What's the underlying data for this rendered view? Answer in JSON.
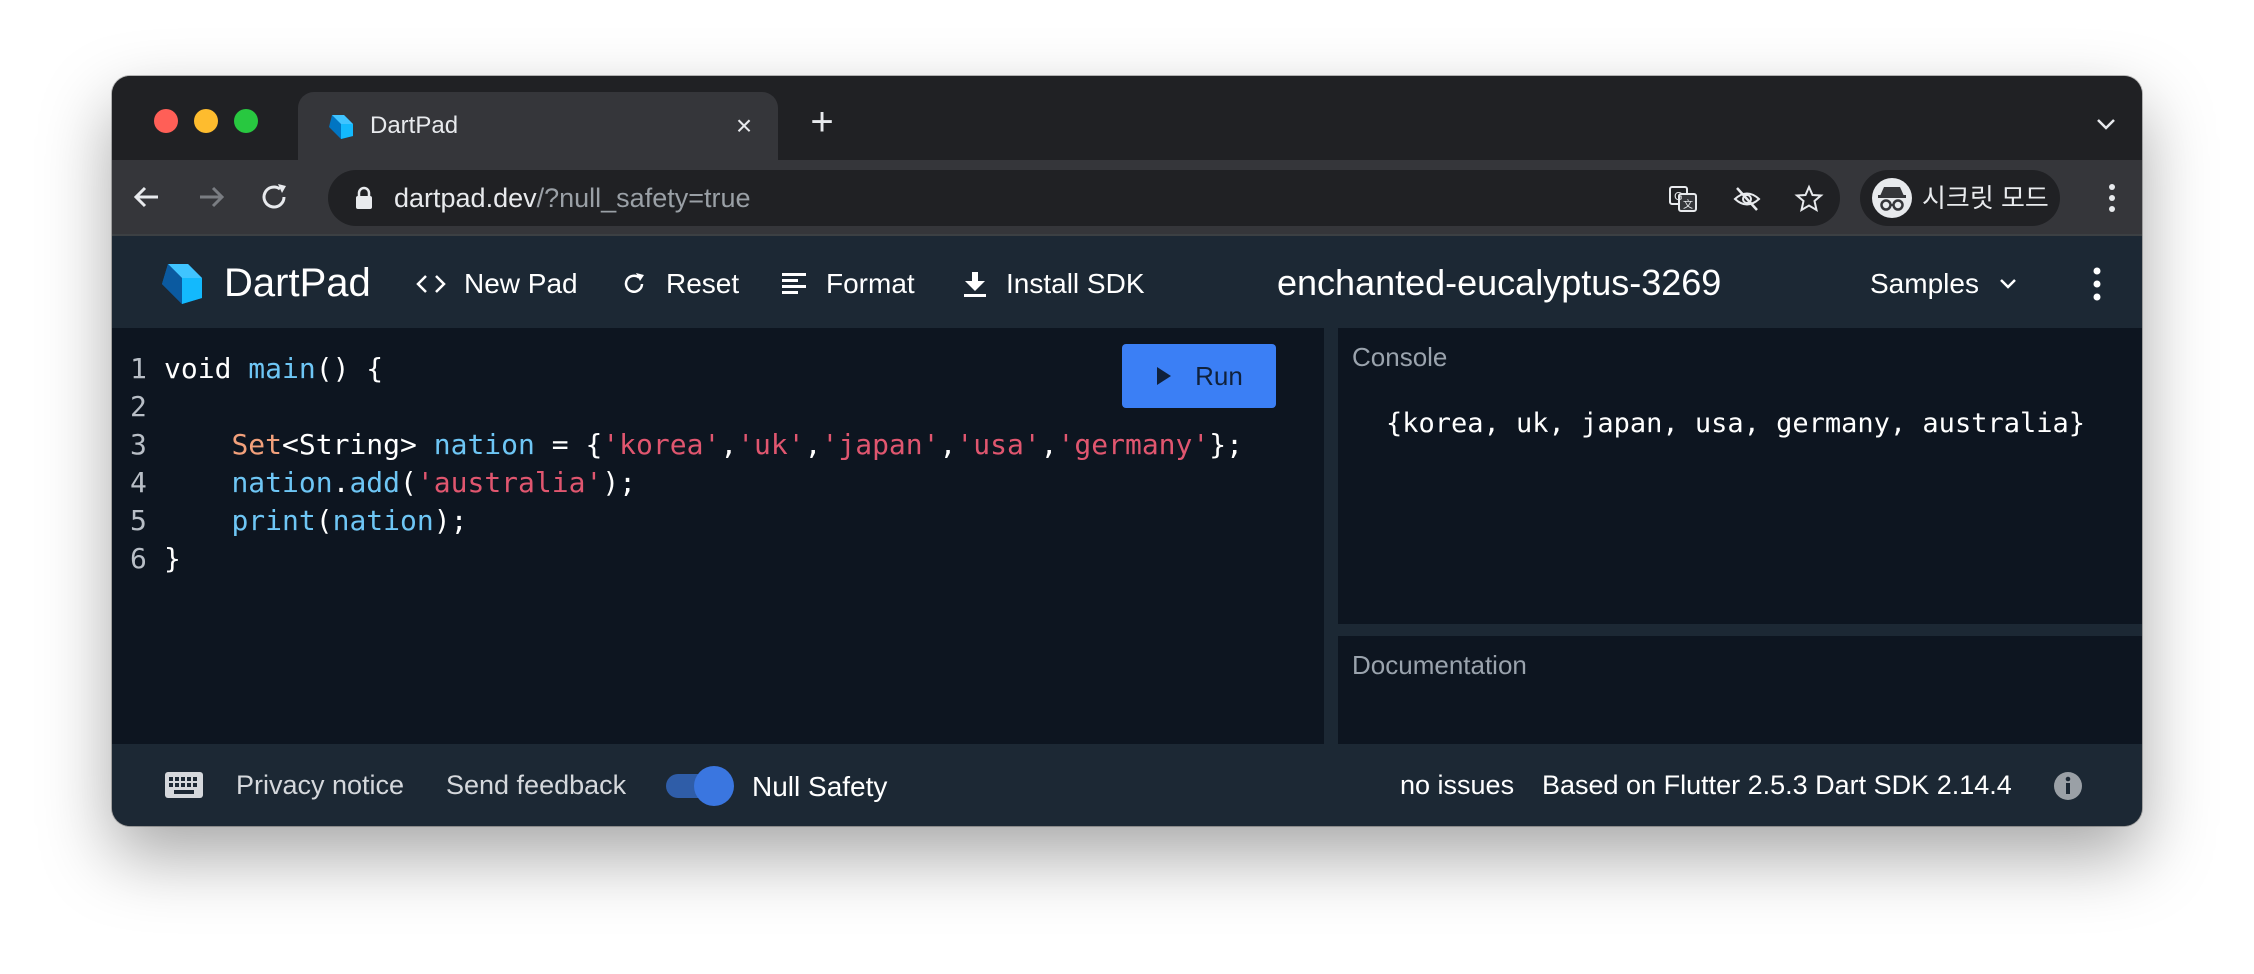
{
  "browser": {
    "tab": {
      "title": "DartPad",
      "close_glyph": "×"
    },
    "new_tab_glyph": "+",
    "address": {
      "host": "dartpad.dev",
      "path": "/?null_safety=true"
    },
    "profile_label": "시크릿 모드",
    "icons": [
      "back-icon",
      "forward-icon",
      "reload-icon",
      "lock-icon",
      "translate-icon",
      "eye-off-icon",
      "star-icon",
      "incognito-icon",
      "kebab-icon",
      "chevron-down-icon"
    ]
  },
  "header": {
    "app_name": "DartPad",
    "buttons": {
      "new_pad": "New Pad",
      "reset": "Reset",
      "format": "Format",
      "install_sdk": "Install SDK"
    },
    "pad_name": "enchanted-eucalyptus-3269",
    "samples": "Samples"
  },
  "editor": {
    "run_label": "Run",
    "line_numbers": [
      "1",
      "2",
      "3",
      "4",
      "5",
      "6"
    ],
    "code_lines": [
      "void main() {",
      "",
      "    Set<String> nation = {'korea','uk','japan','usa','germany'};",
      "    nation.add('australia');",
      "    print(nation);",
      "}"
    ]
  },
  "console": {
    "title": "Console",
    "output": "{korea, uk, japan, usa, germany, australia}"
  },
  "documentation": {
    "title": "Documentation"
  },
  "footer": {
    "privacy": "Privacy notice",
    "feedback": "Send feedback",
    "null_safety_label": "Null Safety",
    "null_safety_on": true,
    "issues": "no issues",
    "version": "Based on Flutter 2.5.3 Dart SDK 2.14.4"
  },
  "colors": {
    "accent": "#3b7ff5",
    "editor_bg": "#0d1520",
    "panel_bg": "#1c2834",
    "string": "#e0566f",
    "identifier": "#6ec6f5",
    "type": "#f2a07b"
  }
}
